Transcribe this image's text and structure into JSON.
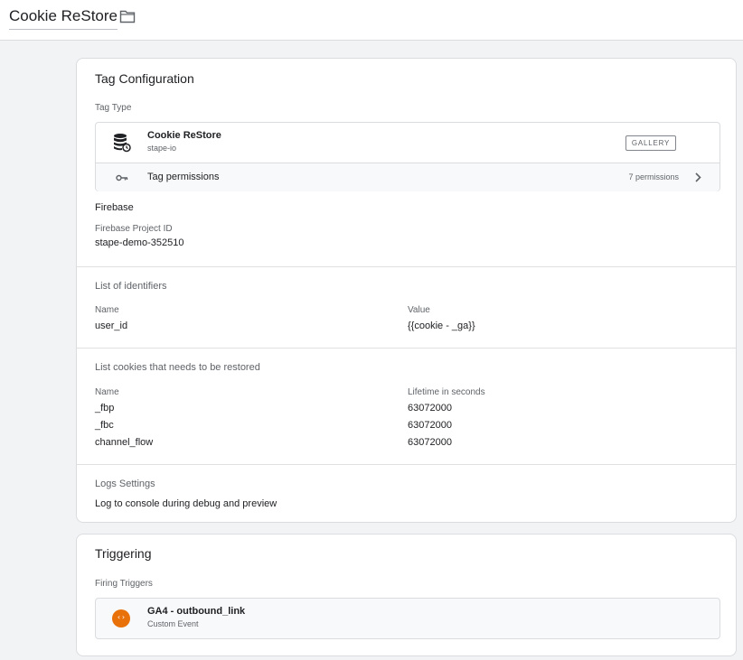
{
  "header": {
    "title": "Cookie ReStore",
    "folder_icon": "folder-icon"
  },
  "config": {
    "title": "Tag Configuration",
    "tag_type_label": "Tag Type",
    "tag_type": {
      "name": "Cookie ReStore",
      "vendor": "stape-io",
      "gallery_label": "GALLERY",
      "icon": "database-restore-icon"
    },
    "permissions": {
      "label": "Tag permissions",
      "count": "7 permissions",
      "icon": "key-icon"
    },
    "firebase": {
      "heading": "Firebase",
      "project_label": "Firebase Project ID",
      "project_value": "stape-demo-352510"
    },
    "identifiers": {
      "title": "List of identifiers",
      "col_name": "Name",
      "col_value": "Value",
      "rows": [
        {
          "name": "user_id",
          "value": "{{cookie - _ga}}"
        }
      ]
    },
    "cookies": {
      "title": "List cookies that needs to be restored",
      "col_name": "Name",
      "col_lifetime": "Lifetime in seconds",
      "rows": [
        {
          "name": "_fbp",
          "lifetime": "63072000"
        },
        {
          "name": "_fbc",
          "lifetime": "63072000"
        },
        {
          "name": "channel_flow",
          "lifetime": "63072000"
        }
      ]
    },
    "logs": {
      "title": "Logs Settings",
      "value": "Log to console during debug and preview"
    }
  },
  "triggering": {
    "title": "Triggering",
    "firing_label": "Firing Triggers",
    "trigger": {
      "name": "GA4 - outbound_link",
      "type": "Custom Event",
      "icon": "custom-event-icon",
      "icon_color": "#e8710a",
      "glyph": "‹›"
    }
  }
}
